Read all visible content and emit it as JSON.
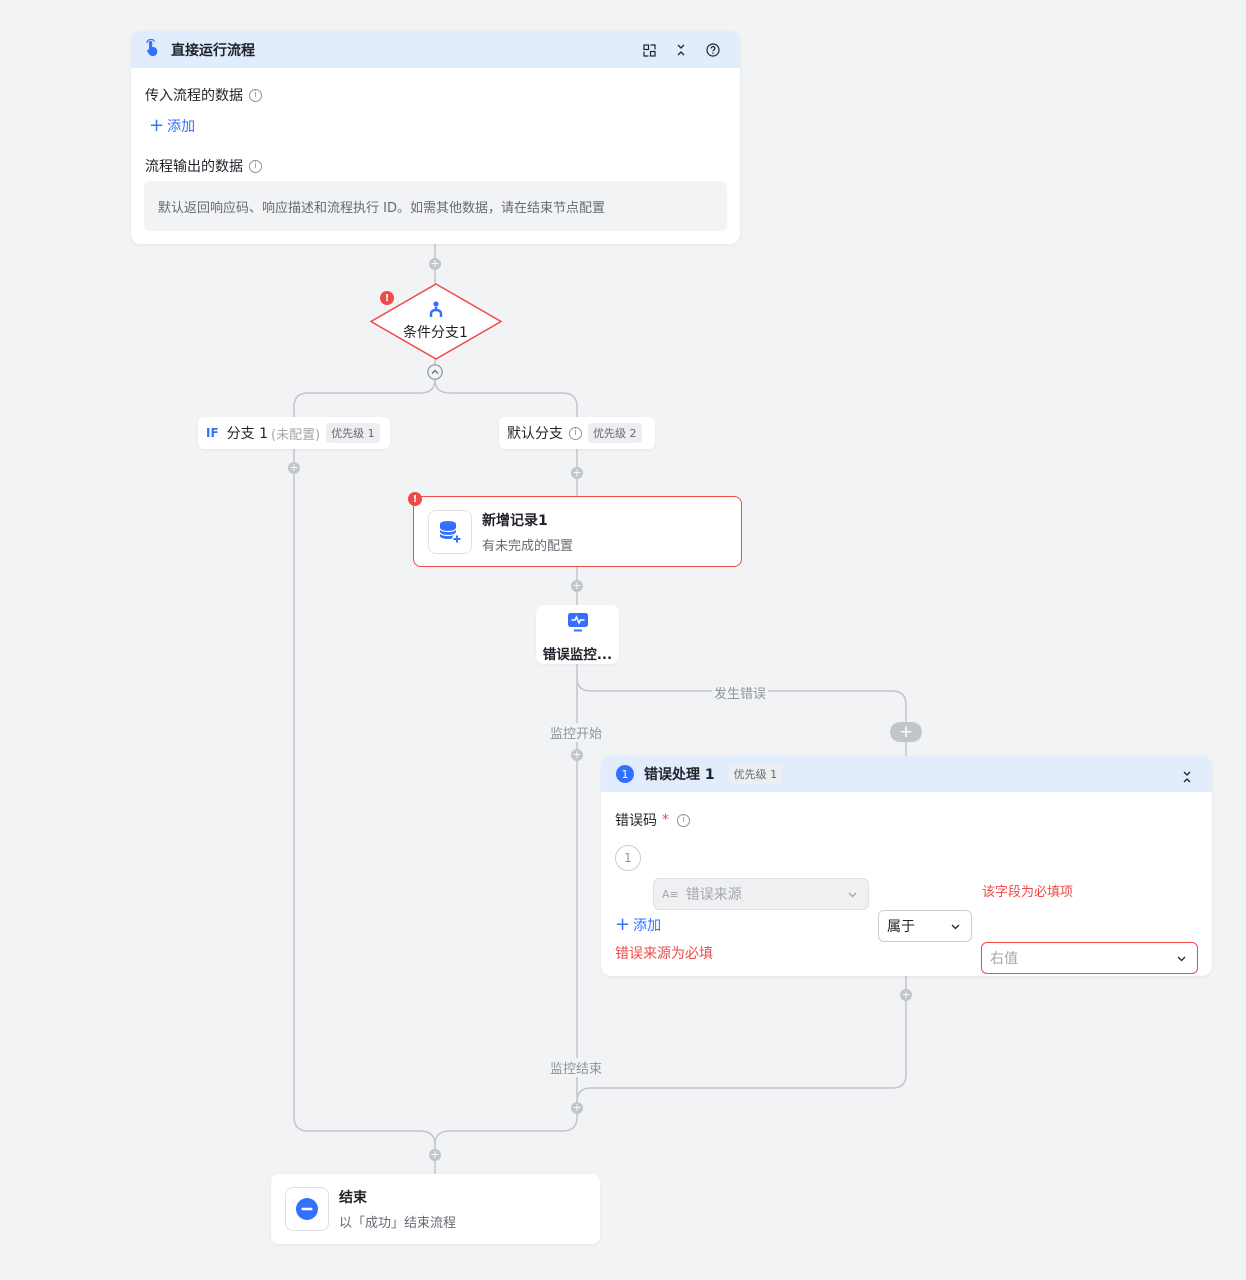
{
  "start_node": {
    "title": "直接运行流程",
    "input_label": "传入流程的数据",
    "add_label": "添加",
    "output_label": "流程输出的数据",
    "output_default": "默认返回响应码、响应描述和流程执行 ID。如需其他数据，请在结束节点配置",
    "icons": [
      "click-icon",
      "collapse-icon",
      "chevron-collapse-icon",
      "help-icon"
    ]
  },
  "condition_node": {
    "label": "条件分支1",
    "has_error": true
  },
  "branches": {
    "if_branch": {
      "tag": "IF",
      "label": "分支 1",
      "note": "(未配置)",
      "priority": "优先级 1"
    },
    "default_branch": {
      "label": "默认分支",
      "priority": "优先级 2"
    }
  },
  "record_node": {
    "title": "新增记录1",
    "subtitle": "有未完成的配置",
    "has_error": true
  },
  "monitor_node": {
    "title": "错误监控..."
  },
  "edges": {
    "error_occurred": "发生错误",
    "monitor_start": "监控开始",
    "monitor_end": "监控结束"
  },
  "error_handler": {
    "index": "1",
    "title": "错误处理 1",
    "priority": "优先级 1",
    "field_label": "错误码",
    "required_mark": "*",
    "row_index": "1",
    "left_value_placeholder": "错误来源",
    "operator_value": "属于",
    "right_value_placeholder": "右值",
    "right_value_error": "该字段为必填项",
    "add_label": "添加",
    "source_error": "错误来源为必填"
  },
  "end_node": {
    "title": "结束",
    "subtitle": "以「成功」结束流程"
  },
  "colors": {
    "accent": "#3370ff",
    "error": "#f04a46",
    "header_bg": "#e1ecfd",
    "canvas_bg": "#f2f3f5",
    "line": "#c2c5cb"
  }
}
